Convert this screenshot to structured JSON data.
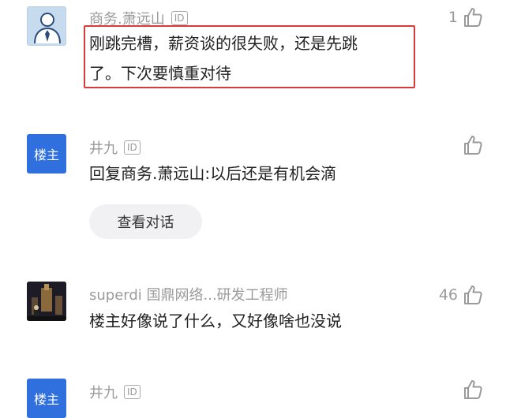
{
  "comments": [
    {
      "username": "商务.萧远山",
      "id_badge": "ID",
      "text_lines": [
        "刚跳完槽，薪资谈的很失败，还是先跳",
        "了。下次要慎重对待"
      ],
      "likes": "1",
      "avatar_icon": "person-icon"
    },
    {
      "username": "井九",
      "id_badge": "ID",
      "avatar_label": "楼主",
      "text_lines": [
        "回复商务.萧远山:以后还是有机会滴"
      ],
      "chip_label": "查看对话",
      "likes": ""
    },
    {
      "username": "superdi 国鼎网络...研发工程师",
      "text_lines": [
        "楼主好像说了什么，又好像啥也没说"
      ],
      "likes": "46",
      "avatar_icon": "photo-avatar"
    },
    {
      "username": "井九",
      "id_badge": "ID",
      "avatar_label": "楼主",
      "likes": ""
    }
  ],
  "colors": {
    "highlight_border": "#d93a3a",
    "owner_badge": "#2f6fde",
    "meta_text": "#9a9a9a"
  }
}
